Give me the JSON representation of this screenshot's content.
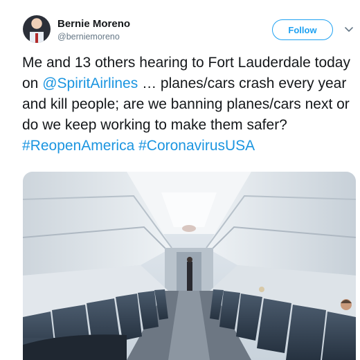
{
  "author": {
    "name": "Bernie Moreno",
    "handle": "@berniemoreno"
  },
  "follow_button": {
    "label": "Follow"
  },
  "tweet": {
    "part1": "Me and 13 others hearing to Fort Lauderdale today on ",
    "mention": "@SpiritAirlines",
    "part2": " … planes/cars crash every year and kill people; are we banning planes/cars next or do we keep working to make them safer?  ",
    "hashtag1": "#ReopenAmerica",
    "space": " ",
    "hashtag2": "#CoronavirusUSA"
  },
  "icons": {
    "more": "chevron-down-icon"
  },
  "colors": {
    "accent": "#1da1f2",
    "link": "#1b95e0",
    "text": "#14171a",
    "muted": "#657786"
  }
}
